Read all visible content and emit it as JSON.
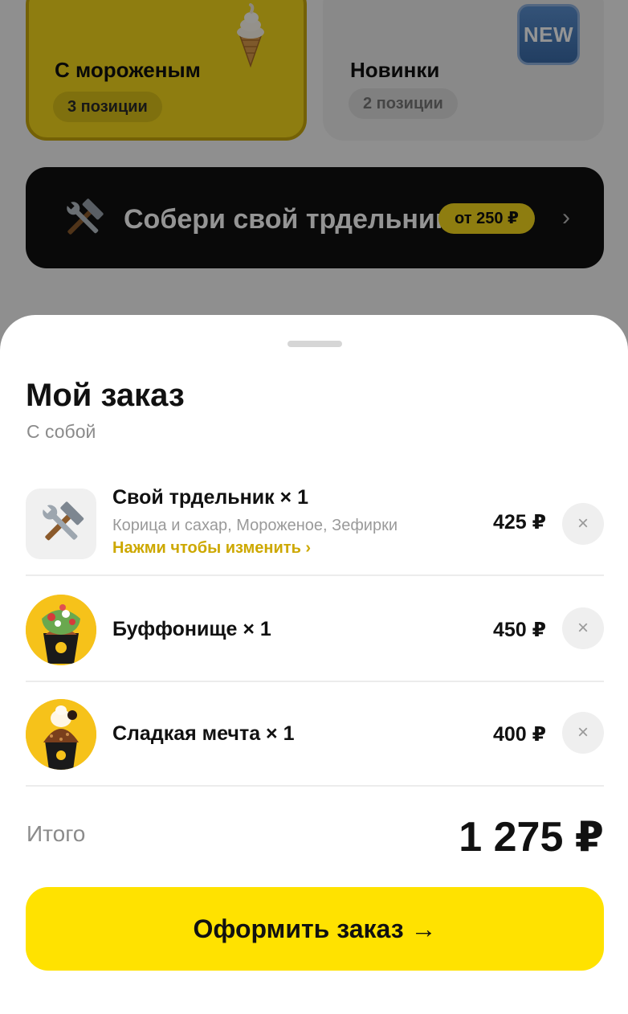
{
  "categories": [
    {
      "title": "С мороженым",
      "count": "3 позиции",
      "icon": "ice-cream-icon"
    },
    {
      "title": "Новинки",
      "count": "2 позиции",
      "icon": "new-badge-icon",
      "badge": "NEW"
    }
  ],
  "builder": {
    "title": "Собери свой трдельник",
    "price": "от 250 ₽",
    "icon": "hammer-wrench-icon"
  },
  "order": {
    "title": "Мой заказ",
    "subtitle": "С собой",
    "items": [
      {
        "name": "Свой трдельник × 1",
        "description": "Корица и сахар, Мороженое, Зефирки",
        "edit": "Нажми чтобы изменить ›",
        "price": "425 ₽",
        "icon": "hammer-wrench-icon"
      },
      {
        "name": "Буффонище × 1",
        "price": "450 ₽",
        "icon": "trdelnik-photo"
      },
      {
        "name": "Сладкая мечта × 1",
        "price": "400 ₽",
        "icon": "trdelnik-photo"
      }
    ],
    "remove_label": "×",
    "total_label": "Итого",
    "total_value": "1 275 ₽",
    "checkout_label": "Оформить заказ →"
  },
  "colors": {
    "accent": "#ffe200",
    "link": "#cda800",
    "banner": "#111111"
  }
}
